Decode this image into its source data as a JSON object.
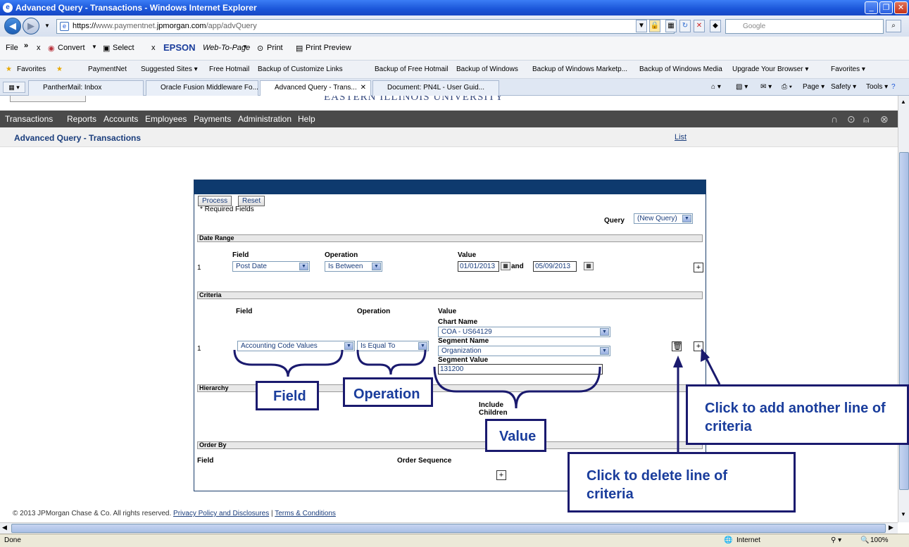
{
  "window": {
    "title": "Advanced Query - Transactions - Windows Internet Explorer",
    "controls": [
      "_",
      "❐",
      "✕"
    ]
  },
  "address": {
    "prefix": "https://",
    "domain": "www.paymentnet.",
    "domain_bold": "jpmorgan.com",
    "path": "/app/advQuery",
    "search_placeholder": "Google"
  },
  "menubar": {
    "file": "File",
    "chevron": "»",
    "close": "x",
    "convert": "Convert",
    "select": "Select",
    "epson": "EPSON",
    "web_to_page": "Web-To-Page",
    "print": "Print",
    "print_preview": "Print Preview"
  },
  "favorites_bar": {
    "favorites": "Favorites",
    "items": [
      "PaymentNet",
      "Suggested Sites ▾",
      "Free Hotmail",
      "Backup of Customize Links",
      "Backup of Free Hotmail",
      "Backup of Windows",
      "Backup of Windows Marketp...",
      "Backup of Windows Media",
      "Upgrade Your Browser ▾",
      "Favorites ▾"
    ]
  },
  "tabs": {
    "items": [
      "PantherMail: Inbox",
      "Oracle Fusion Middleware Fo...",
      "Advanced Query - Trans...",
      "Document: PN4L - User Guid..."
    ],
    "commands": [
      "Page ▾",
      "Safety ▾",
      "Tools ▾"
    ]
  },
  "app": {
    "banner_text": "EASTERN ILLINOIS UNIVERSITY",
    "nav": [
      "Transactions",
      "Reports",
      "Accounts",
      "Employees",
      "Payments",
      "Administration",
      "Help"
    ],
    "page_title": "Advanced Query - Transactions",
    "list_link": "List"
  },
  "form": {
    "process": "Process",
    "reset": "Reset",
    "required_note": "* Required Fields",
    "query_label": "Query",
    "query_value": "(New Query)",
    "date_range": {
      "header": "Date Range",
      "field_label": "Field",
      "operation_label": "Operation",
      "value_label": "Value",
      "row_num": "1",
      "field_value": "Post Date",
      "operation_value": "Is Between",
      "start_date": "01/01/2013",
      "and_label": "and",
      "end_date": "05/09/2013"
    },
    "criteria": {
      "header": "Criteria",
      "field_label": "Field",
      "operation_label": "Operation",
      "value_label": "Value",
      "row_num": "1",
      "field_value": "Accounting Code Values",
      "operation_value": "Is Equal To",
      "chart_name_label": "Chart Name",
      "chart_name_value": "COA - US64129",
      "segment_name_label": "Segment Name",
      "segment_name_value": "Organization",
      "segment_value_label": "Segment Value",
      "segment_value": "131200"
    },
    "hierarchy": {
      "header": "Hierarchy",
      "include_children": "Include Children"
    },
    "order_by": {
      "header": "Order By",
      "field_label": "Field",
      "order_sequence_label": "Order Sequence"
    }
  },
  "footer": {
    "copyright": "© 2013 JPMorgan Chase & Co. All rights reserved.",
    "privacy": "Privacy Policy and Disclosures",
    "separator": "|",
    "terms": "Terms & Conditions"
  },
  "status": {
    "left": "Done",
    "zone": "Internet",
    "zoom": "100%"
  },
  "callouts": {
    "field": "Field",
    "operation": "Operation",
    "value": "Value",
    "add": "Click to add another line of criteria",
    "delete": "Click to delete line of criteria"
  },
  "colors": {
    "accent": "#0e3a6e",
    "callout_text": "#1a3d9c",
    "callout_border": "#1a1a6e",
    "nav_bg": "#4a4a4a"
  }
}
